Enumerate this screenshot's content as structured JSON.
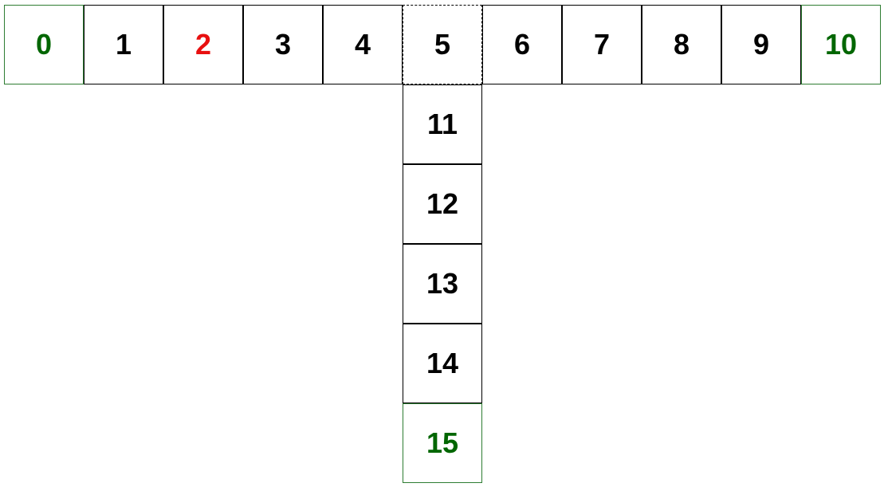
{
  "colors": {
    "endpoint_text": "#006600",
    "endpoint_border": "#2e7d32",
    "highlight_text": "#e81010",
    "default": "#000000"
  },
  "row_cells": [
    "0",
    "1",
    "2",
    "3",
    "4",
    "5",
    "6",
    "7",
    "8",
    "9",
    "10"
  ],
  "column_cells": [
    "11",
    "12",
    "13",
    "14",
    "15"
  ],
  "endpoints": [
    "0",
    "10",
    "15"
  ],
  "highlighted": [
    "2"
  ],
  "junction": "5"
}
